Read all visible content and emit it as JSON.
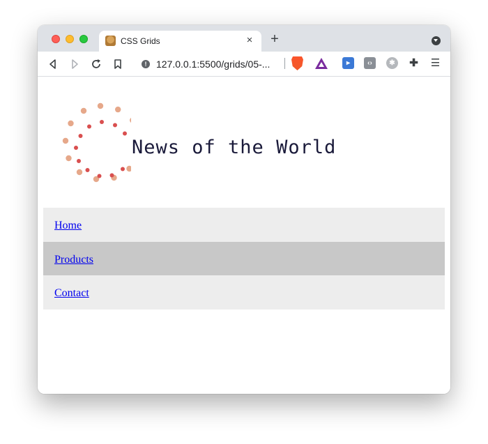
{
  "browser": {
    "tab_title": "CSS Grids",
    "tab_close": "×",
    "new_tab": "+",
    "url": "127.0.0.1:5500/grids/05-...",
    "icons": {
      "back": "back-arrow-icon",
      "forward": "forward-arrow-icon",
      "reload": "reload-icon",
      "bookmark": "bookmark-icon",
      "info": "info-icon",
      "brave": "brave-shield-icon",
      "rewards": "bat-rewards-icon",
      "ext1": "extension-reader-icon",
      "ext2": "extension-code-icon",
      "ext3": "extension-gear-icon",
      "puzzle": "extensions-puzzle-icon",
      "menu": "menu-icon",
      "tab_search": "tab-search-icon"
    }
  },
  "page": {
    "title": "News of the World",
    "nav": [
      {
        "label": "Home"
      },
      {
        "label": "Products"
      },
      {
        "label": "Contact"
      }
    ]
  },
  "colors": {
    "nav_light": "#ededed",
    "nav_dark": "#c8c8c8",
    "link": "#0000ee",
    "logo_outer": "#e6a88a",
    "logo_inner": "#d94f4f"
  }
}
